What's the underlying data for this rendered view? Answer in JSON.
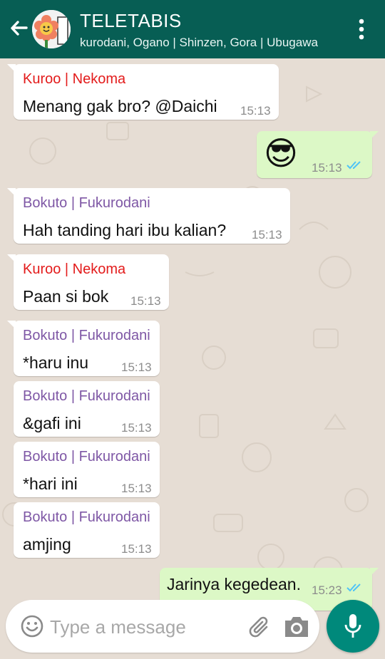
{
  "header": {
    "title": "TELETABIS",
    "subtitle": "kurodani, Ogano | Shinzen, Gora | Ubugawa",
    "back_icon": "arrow-back-icon",
    "menu_icon": "more-vert-icon"
  },
  "colors": {
    "header_bg": "#075e54",
    "outgoing_bg": "#dcf8c6",
    "incoming_bg": "#ffffff",
    "sender_red": "#e31b1b",
    "sender_purple": "#7e57a5",
    "mic_bg": "#00897b",
    "read_ticks": "#4fc3f7"
  },
  "messages": [
    {
      "sender": "Kuroo | Nekoma",
      "text": "Menang gak bro? @Daichi",
      "time": "15:13"
    },
    {
      "text": "😎",
      "time": "15:13",
      "status": "read"
    },
    {
      "sender": "Bokuto | Fukurodani",
      "text": "Hah tanding hari ibu kalian?",
      "time": "15:13"
    },
    {
      "sender": "Kuroo | Nekoma",
      "text": "Paan si bok",
      "time": "15:13"
    },
    {
      "sender": "Bokuto | Fukurodani",
      "text": "*haru inu",
      "time": "15:13"
    },
    {
      "sender": "Bokuto | Fukurodani",
      "text": "&gafi ini",
      "time": "15:13"
    },
    {
      "sender": "Bokuto | Fukurodani",
      "text": "*hari ini",
      "time": "15:13"
    },
    {
      "sender": "Bokuto | Fukurodani",
      "text": "amjing",
      "time": "15:13"
    },
    {
      "text": "Jarinya kegedean.",
      "time": "15:23",
      "status": "read"
    }
  ],
  "composer": {
    "placeholder": "Type a message",
    "value": "",
    "emoji_icon": "emoji-icon",
    "attach_icon": "paperclip-icon",
    "camera_icon": "camera-icon",
    "mic_icon": "microphone-icon"
  }
}
